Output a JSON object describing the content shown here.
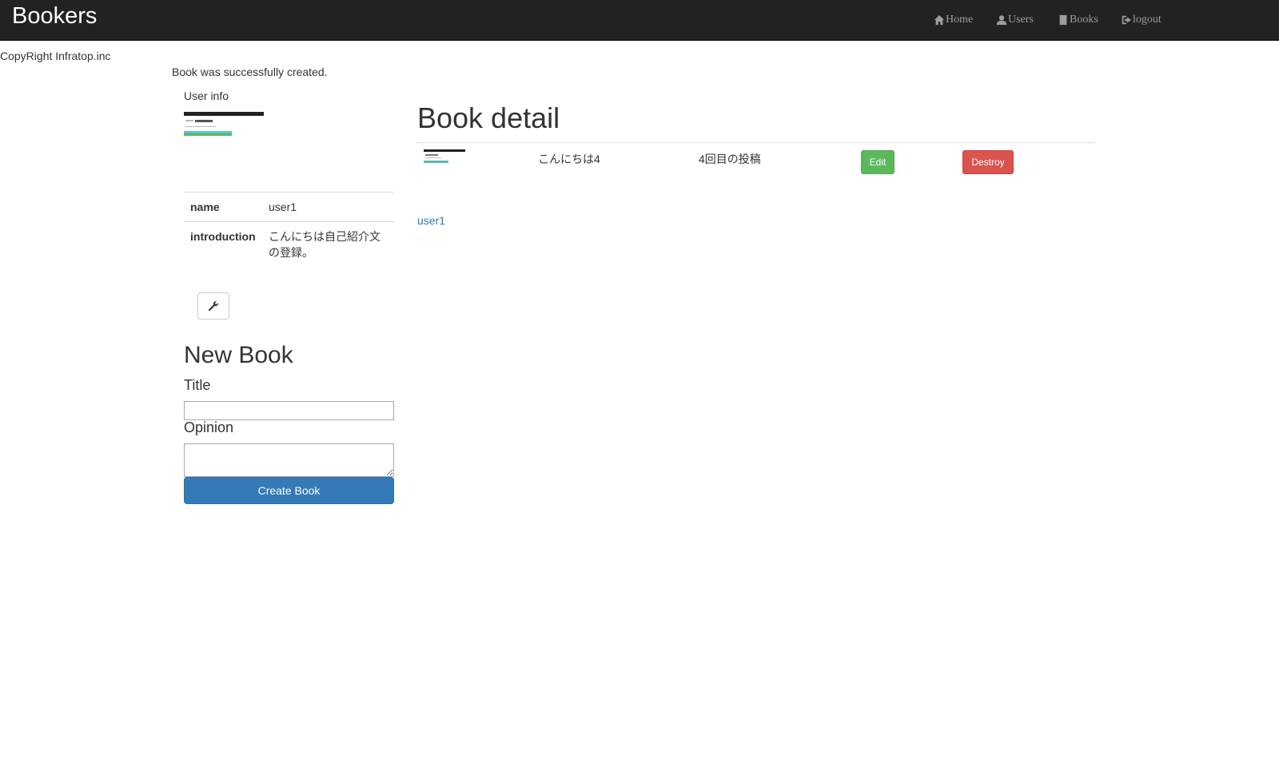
{
  "navbar": {
    "brand": "Bookers",
    "items": [
      {
        "label": "Home",
        "icon": "home-icon"
      },
      {
        "label": "Users",
        "icon": "user-icon"
      },
      {
        "label": "Books",
        "icon": "book-icon"
      },
      {
        "label": "logout",
        "icon": "logout-icon"
      }
    ],
    "background": "#222222",
    "link_color": "#9d9d9d"
  },
  "footer": {
    "copyright": "CopyRight Infratop.inc"
  },
  "flash": {
    "notice": "Book was successfully created."
  },
  "sidebar": {
    "user_info_label": "User info",
    "rows": [
      {
        "key": "name",
        "value": "user1"
      },
      {
        "key": "introduction",
        "value": "こんにちは自己紹介文の登録。"
      }
    ],
    "edit_icon": "wrench-icon",
    "new_book": {
      "heading": "New Book",
      "title_label": "Title",
      "opinion_label": "Opinion",
      "submit_label": "Create Book",
      "title_value": "",
      "opinion_value": ""
    }
  },
  "main": {
    "heading": "Book detail",
    "book": {
      "title": "こんにちは4",
      "opinion": "4回目の投稿",
      "edit_label": "Edit",
      "destroy_label": "Destroy"
    },
    "user_link": "user1"
  },
  "colors": {
    "primary": "#337ab7",
    "success": "#5cb85c",
    "danger": "#d9534f"
  }
}
